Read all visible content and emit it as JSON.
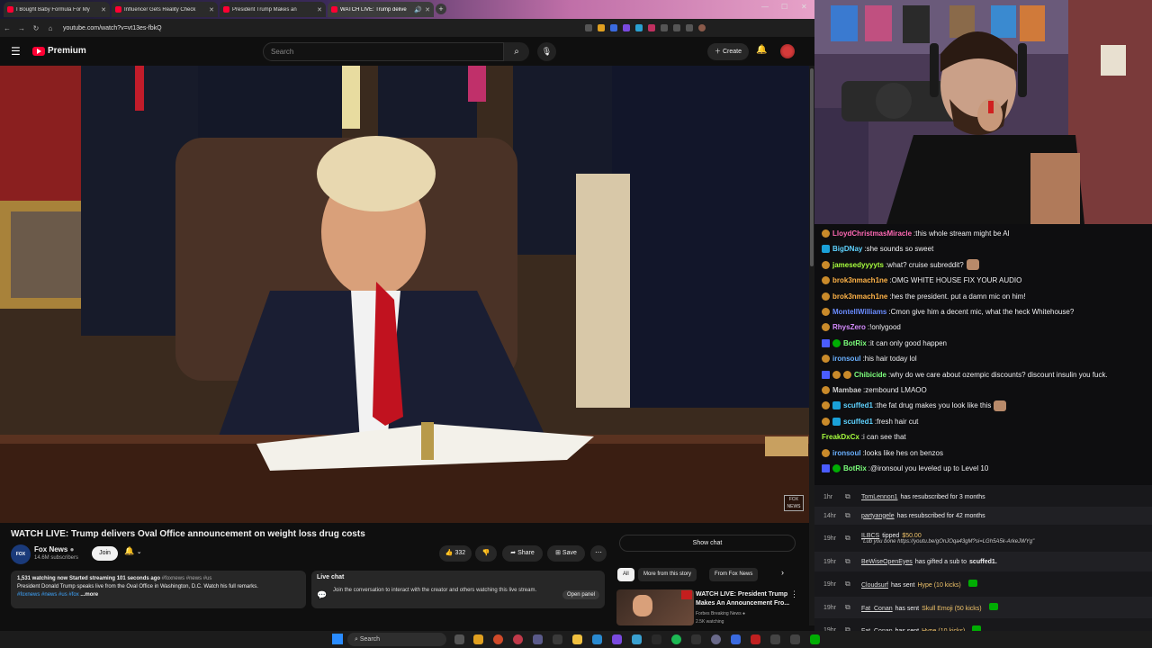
{
  "browser": {
    "tabs": [
      {
        "title": "I Bought Baby Formula For My"
      },
      {
        "title": "Influencer Gets Reality Check"
      },
      {
        "title": "President Trump Makes an"
      },
      {
        "title": "WATCH LIVE: Trump delive"
      }
    ],
    "new_tab": "+",
    "url": "youtube.com/watch?v=vt13es-fbkQ"
  },
  "youtube": {
    "logo": "Premium",
    "search_placeholder": "Search",
    "create_label": "Create",
    "video": {
      "title": "WATCH LIVE: Trump delivers Oval Office announcement on weight loss drug costs",
      "channel": "Fox News",
      "subscribers": "14.6M subscribers",
      "join": "Join",
      "likes": "332",
      "share": "Share",
      "save": "Save",
      "watermark": "FOX NEWS"
    },
    "description": {
      "stats": "1,531 watching now  Started streaming 101 seconds ago",
      "tags_inline": "#foxnews #news #us",
      "text": "President Donald Trump speaks live from the Oval Office in Washington, D.C. Watch his full remarks.",
      "tags": "#foxnews #news #us #fox",
      "more": "...more"
    },
    "live_chat": {
      "title": "Live chat",
      "text": "Join the conversation to interact with the creator and others watching this live stream.",
      "open_panel": "Open panel"
    },
    "show_chat": "Show chat",
    "chips": [
      "All",
      "More from this story",
      "From Fox News"
    ],
    "related": {
      "title": "WATCH LIVE: President Trump Makes An Announcement Fro...",
      "channel": "Forbes Breaking News",
      "watching": "2.5K watching"
    }
  },
  "twitch_chat": [
    {
      "user": "LloydChristmasMiracle",
      "color": "#ff69b4",
      "text": "this whole stream might be AI",
      "icons": [
        "o"
      ]
    },
    {
      "user": "BigDNay",
      "color": "#5fd3ff",
      "text": "she sounds so sweet",
      "icons": [
        "b"
      ]
    },
    {
      "user": "jamesedyyyyts",
      "color": "#a8ff3e",
      "text": "what? cruise subreddit?",
      "icons": [
        "o"
      ],
      "emote": true
    },
    {
      "user": "brok3nmach1ne",
      "color": "#ffb347",
      "text": "OMG WHITE HOUSE FIX YOUR AUDIO",
      "icons": [
        "o"
      ]
    },
    {
      "user": "brok3nmach1ne",
      "color": "#ffb347",
      "text": "hes the president. put a damn mic on him!",
      "icons": [
        "o"
      ]
    },
    {
      "user": "MontellWilliams",
      "color": "#6a8cff",
      "text": "Cmon give him a decent mic, what the heck Whitehouse?",
      "icons": [
        "o"
      ]
    },
    {
      "user": "RhysZero",
      "color": "#d68cff",
      "text": "!onlygood",
      "icons": [
        "o"
      ]
    },
    {
      "user": "BotRix",
      "color": "#7cff7c",
      "text": "it can only good happen",
      "icons": [
        "p",
        "g"
      ]
    },
    {
      "user": "ironsoul",
      "color": "#6ab0ff",
      "text": "his hair today lol",
      "icons": [
        "o"
      ]
    },
    {
      "user": "Chibicide",
      "color": "#7cff7c",
      "text": "why do we care about ozempic discounts? discount insulin you fuck.",
      "icons": [
        "p",
        "o",
        "o"
      ]
    },
    {
      "user": "Mambae",
      "color": "#cccccc",
      "text": "zembound LMAOO",
      "icons": [
        "o"
      ]
    },
    {
      "user": "scuffed1",
      "color": "#5fd3ff",
      "text": "the fat drug makes you look like this",
      "icons": [
        "o",
        "b"
      ],
      "emote": true
    },
    {
      "user": "scuffed1",
      "color": "#5fd3ff",
      "text": "fresh hair cut",
      "icons": [
        "o",
        "b"
      ]
    },
    {
      "user": "FreakDxCx",
      "color": "#a8ff3e",
      "text": "i can see that",
      "icons": []
    },
    {
      "user": "ironsoul",
      "color": "#6ab0ff",
      "text": "looks like hes on benzos",
      "icons": [
        "o"
      ]
    },
    {
      "user": "BotRix",
      "color": "#7cff7c",
      "text": "@ironsoul you leveled up to Level 10",
      "icons": [
        "p",
        "g"
      ]
    }
  ],
  "events": [
    {
      "time": "1hr",
      "user": "TomLennon1",
      "text": "has resubscribed for 3 months"
    },
    {
      "time": "14hr",
      "user": "partyangele",
      "text": "has resubscribed for 42 months"
    },
    {
      "time": "19hr",
      "user": "ILBCS",
      "text": "tipped",
      "amount": "$50.00",
      "quote": "\"Lub you bone https://youtu.be/gOnJOqa43gM?si=LGh5A5k-ArkeJWYg\""
    },
    {
      "time": "19hr",
      "user": "BeWiseOpenEyes",
      "text": "has gifted a sub to",
      "target": "scuffed1."
    },
    {
      "time": "19hr",
      "user": "Cloudsurf",
      "text": "has sent",
      "item": "Hype (10 kicks)"
    },
    {
      "time": "19hr",
      "user": "Fat_Conan",
      "text": "has sent",
      "item": "Skull Emoji (50 kicks)"
    },
    {
      "time": "19hr",
      "user": "Fat_Conan",
      "text": "has sent",
      "item": "Hype (10 kicks)"
    }
  ],
  "taskbar": {
    "search": "Search"
  }
}
